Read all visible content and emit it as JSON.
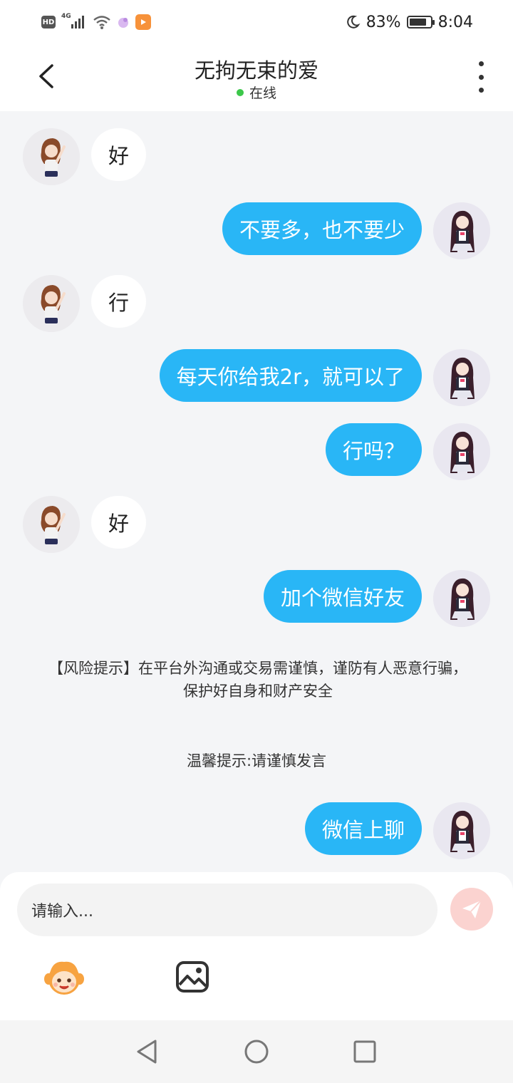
{
  "status_bar": {
    "hd": "HD",
    "network": "4G",
    "battery_percent": "83%",
    "battery_level": 0.83,
    "time": "8:04",
    "icons": [
      "hd-icon",
      "signal-icon",
      "wifi-icon",
      "app-notification-icon",
      "video-app-icon",
      "moon-icon",
      "battery-icon"
    ]
  },
  "header": {
    "title": "无拘无束的爱",
    "status": "在线",
    "status_color": "#3cc74a",
    "back_icon": "chevron-left-icon",
    "more_icon": "more-vertical-icon"
  },
  "messages": [
    {
      "side": "left",
      "text": "好"
    },
    {
      "side": "right",
      "text": "不要多，也不要少"
    },
    {
      "side": "left",
      "text": "行"
    },
    {
      "side": "right",
      "text": "每天你给我2r，就可以了"
    },
    {
      "side": "right",
      "text": "行吗？"
    },
    {
      "side": "left",
      "text": "好"
    },
    {
      "side": "right",
      "text": "加个微信好友"
    },
    {
      "side": "right",
      "text": "微信上聊"
    }
  ],
  "notices": {
    "risk": "【风险提示】在平台外沟通或交易需谨慎，谨防有人恶意行骗，保护好自身和财产安全",
    "tip": "温馨提示:请谨慎发言"
  },
  "composer": {
    "placeholder": "请输入...",
    "send_icon": "send-icon",
    "emoji_icon": "emoji-face-icon",
    "image_icon": "image-icon"
  },
  "colors": {
    "accent": "#29b6f6",
    "send_button": "#fbd3d0",
    "background": "#f4f5f7"
  },
  "navigation": {
    "icons": [
      "nav-back-icon",
      "nav-home-icon",
      "nav-recents-icon"
    ]
  }
}
